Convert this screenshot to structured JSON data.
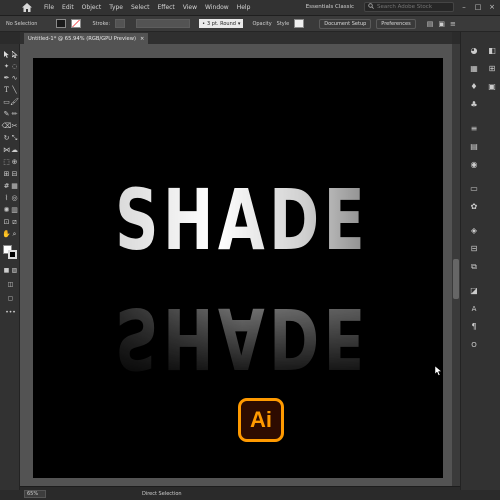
{
  "menubar": {
    "items": [
      "File",
      "Edit",
      "Object",
      "Type",
      "Select",
      "Effect",
      "View",
      "Window",
      "Help"
    ],
    "workspace": "Essentials Classic",
    "search_placeholder": "Search Adobe Stock"
  },
  "controlbar": {
    "selection_label": "No Selection",
    "stroke_label": "Stroke:",
    "brush_value": "3 pt. Round",
    "opacity_label": "Opacity",
    "style_label": "Style",
    "document_setup": "Document Setup",
    "preferences": "Preferences"
  },
  "document": {
    "tab_title": "Untitled-1* @ 65.94% (RGB/GPU Preview)",
    "close": "×"
  },
  "artwork": {
    "headline": "SHADE",
    "logo_text": "Ai",
    "colors": {
      "logo_bg": "#2d0b00",
      "logo_accent": "#ff9a00",
      "artboard": "#000000"
    }
  },
  "statusbar": {
    "zoom": "65%",
    "tool": "Direct Selection"
  },
  "icons": [
    "home-icon",
    "search-icon",
    "minimize-icon",
    "maximize-icon",
    "close-icon"
  ]
}
